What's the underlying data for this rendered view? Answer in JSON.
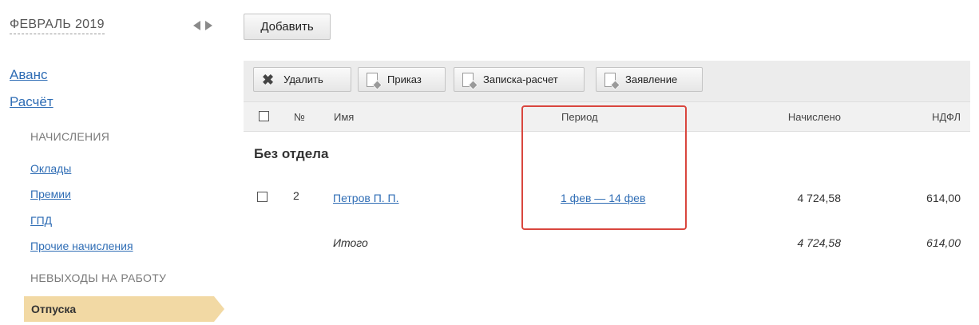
{
  "sidebar": {
    "month": "ФЕВРАЛЬ 2019",
    "nav_top": [
      "Аванс",
      "Расчёт"
    ],
    "sections": {
      "accruals_title": "НАЧИСЛЕНИЯ",
      "accruals": [
        "Оклады",
        "Премии",
        "ГПД",
        "Прочие начисления"
      ],
      "absence_title": "НЕВЫХОДЫ НА РАБОТУ",
      "active": "Отпуска"
    }
  },
  "toolbar": {
    "add": "Добавить",
    "delete": "Удалить",
    "order": "Приказ",
    "note": "Записка-расчет",
    "statement": "Заявление"
  },
  "table": {
    "headers": {
      "num": "№",
      "name": "Имя",
      "period": "Период",
      "accrued": "Начислено",
      "ndfl": "НДФЛ"
    },
    "group": "Без отдела",
    "row": {
      "num": "2",
      "name": "Петров П. П.",
      "period": "1 фев — 14 фев",
      "accrued": "4 724,58",
      "ndfl": "614,00"
    },
    "total": {
      "label": "Итого",
      "accrued": "4 724,58",
      "ndfl": "614,00"
    }
  },
  "colors": {
    "link": "#2f6db5",
    "active_bg": "#f2d9a4",
    "highlight": "#d9463e"
  }
}
